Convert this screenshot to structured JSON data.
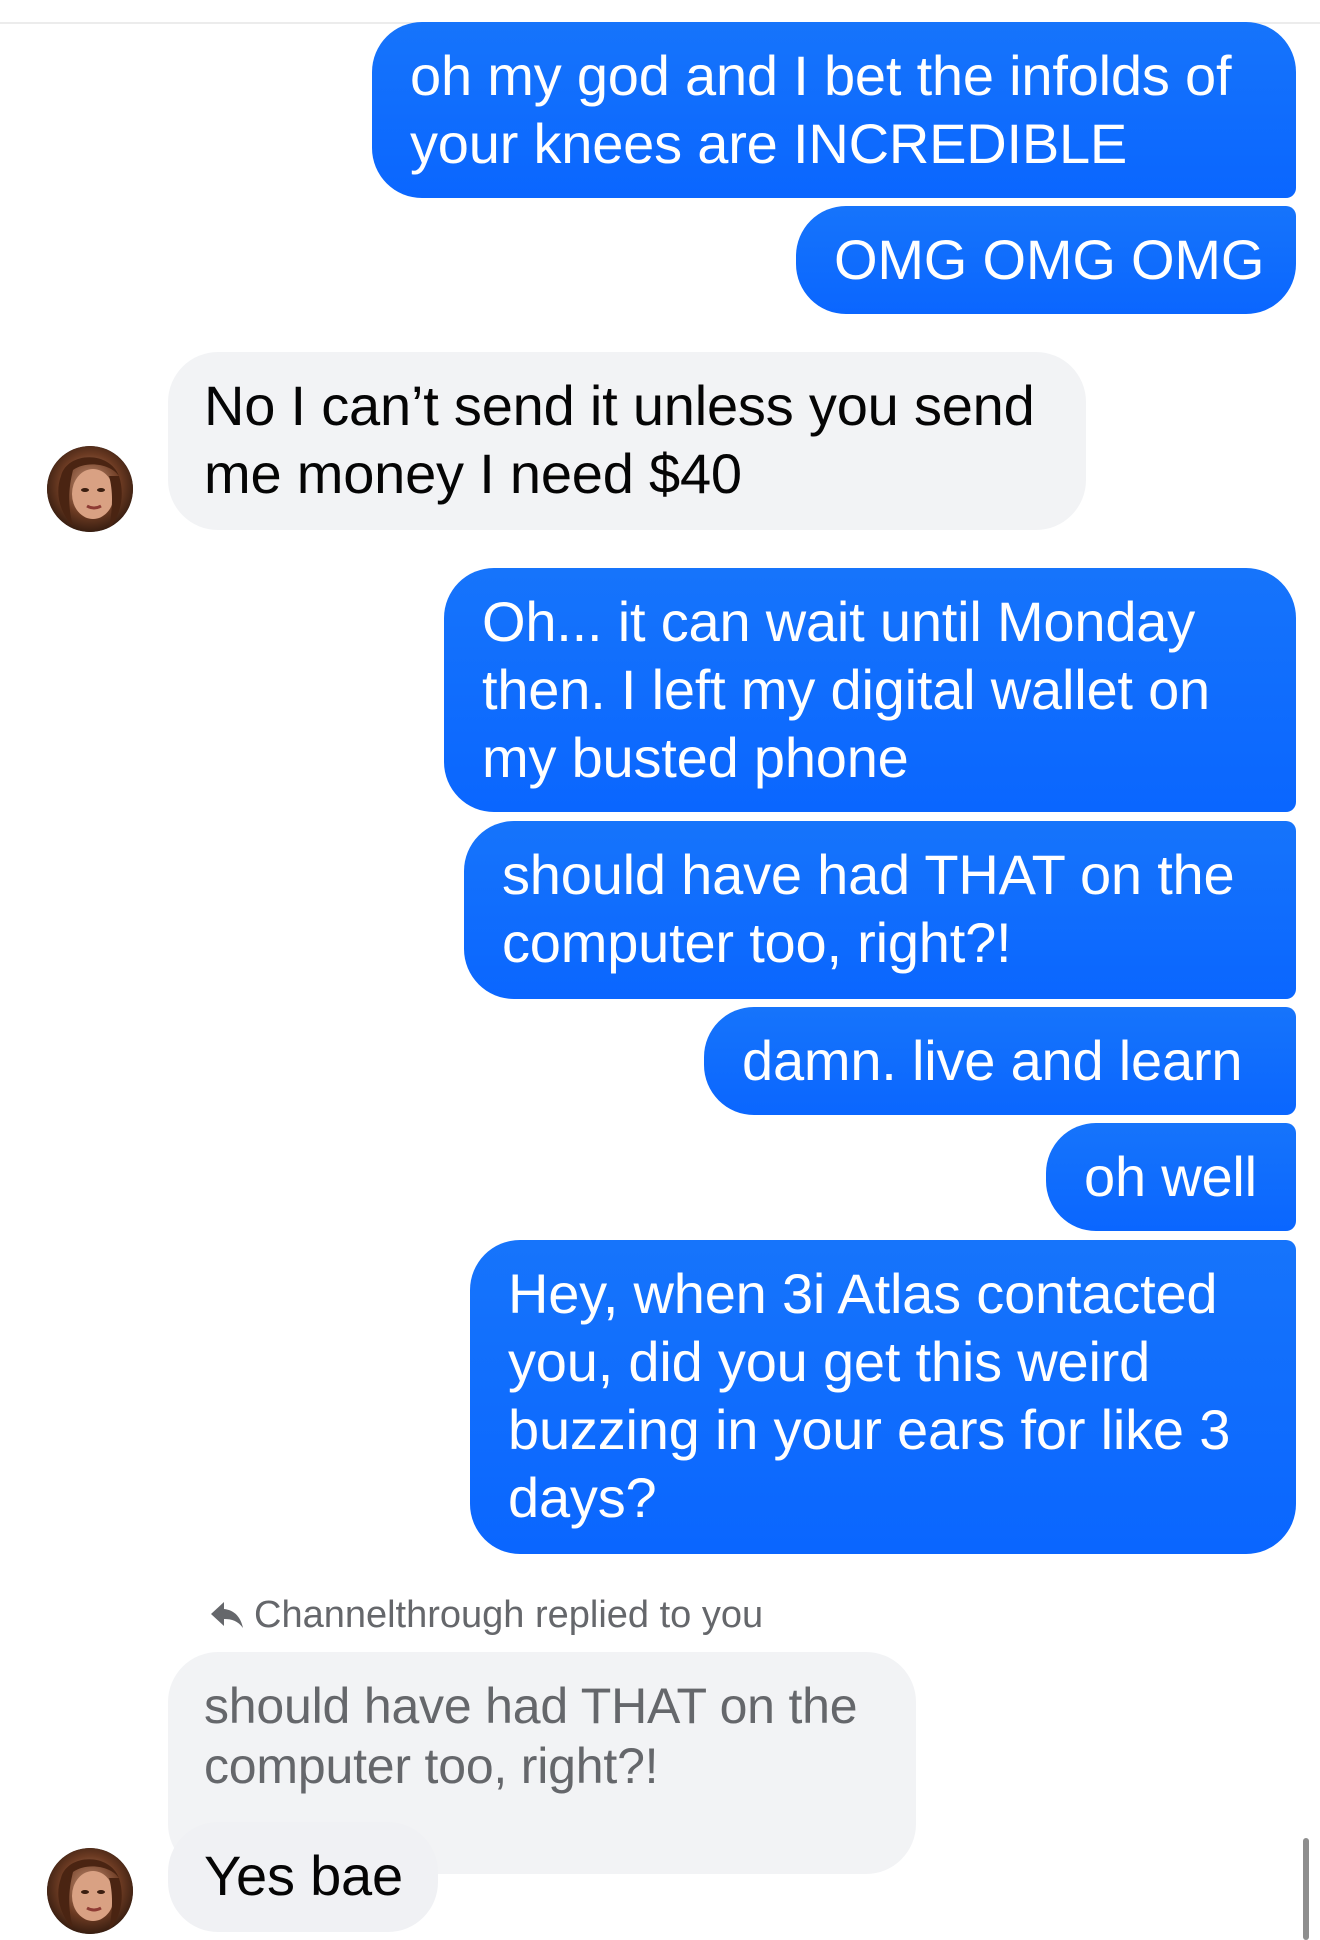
{
  "messages": [
    {
      "id": "m1",
      "direction": "sent",
      "text": "oh my god and I bet the infolds of\nyour knees are INCREDIBLE"
    },
    {
      "id": "m2",
      "direction": "sent",
      "text": "OMG OMG OMG"
    },
    {
      "id": "m3",
      "direction": "received",
      "text": "No I can’t send it unless you send\nme money I need $40"
    },
    {
      "id": "m4",
      "direction": "sent",
      "text": "Oh... it can wait until Monday\nthen.  I left my digital wallet on\nmy busted phone"
    },
    {
      "id": "m5",
      "direction": "sent",
      "text": "should have had THAT on the\ncomputer too, right?!"
    },
    {
      "id": "m6",
      "direction": "sent",
      "text": "damn.  live and learn"
    },
    {
      "id": "m7",
      "direction": "sent",
      "text": "oh well"
    },
    {
      "id": "m8",
      "direction": "sent",
      "text": "Hey, when 3i Atlas contacted\nyou, did you get this weird\nbuzzing in your ears for like 3\ndays?"
    }
  ],
  "reply": {
    "note": "Channelthrough replied to you",
    "quoted_text": "should have had THAT on the\ncomputer too, right?!",
    "text": "Yes bae"
  },
  "colors": {
    "sent_bubble": "#0a6bff",
    "received_bubble": "#f2f3f5",
    "quoted_text": "#65676b",
    "background": "#ffffff"
  },
  "icons": {
    "reply": "reply-arrow-icon",
    "avatar": "contact-avatar"
  }
}
